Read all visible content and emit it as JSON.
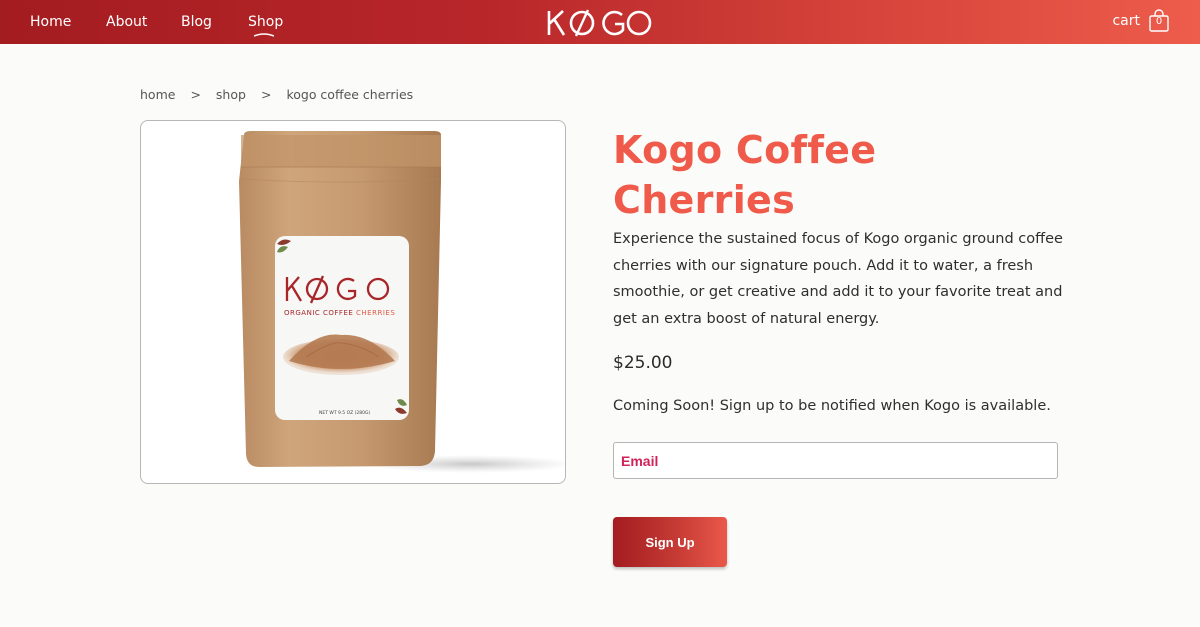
{
  "header": {
    "nav": [
      {
        "label": "Home"
      },
      {
        "label": "About"
      },
      {
        "label": "Blog"
      },
      {
        "label": "Shop",
        "active": true
      }
    ],
    "logo_text": "KOGO",
    "cart_label": "cart",
    "cart_count": "0"
  },
  "breadcrumb": {
    "home": "home",
    "separator": ">",
    "shop": "shop",
    "current": "kogo coffee cherries"
  },
  "product": {
    "title": "Kogo Coffee Cherries",
    "description": "Experience the sustained focus of Kogo organic ground coffee cherries with our signature pouch. Add it to water, a fresh smoothie, or get creative and add it to your favorite treat and get an extra boost of natural energy.",
    "price": "$25.00",
    "availability_note": "Coming Soon! Sign up to be notified when Kogo is available.",
    "image": {
      "label_logo": "KOGO",
      "label_subtitle_a": "ORGANIC COFFEE",
      "label_subtitle_b": "CHERRIES",
      "label_weight": "NET WT 9.5 OZ (280G)"
    }
  },
  "signup": {
    "email_placeholder": "Email",
    "button_label": "Sign Up"
  },
  "colors": {
    "brand_dark": "#a31c20",
    "brand_light": "#ee5c4c",
    "title": "#ef5a4a",
    "email_placeholder": "#d1235a"
  }
}
